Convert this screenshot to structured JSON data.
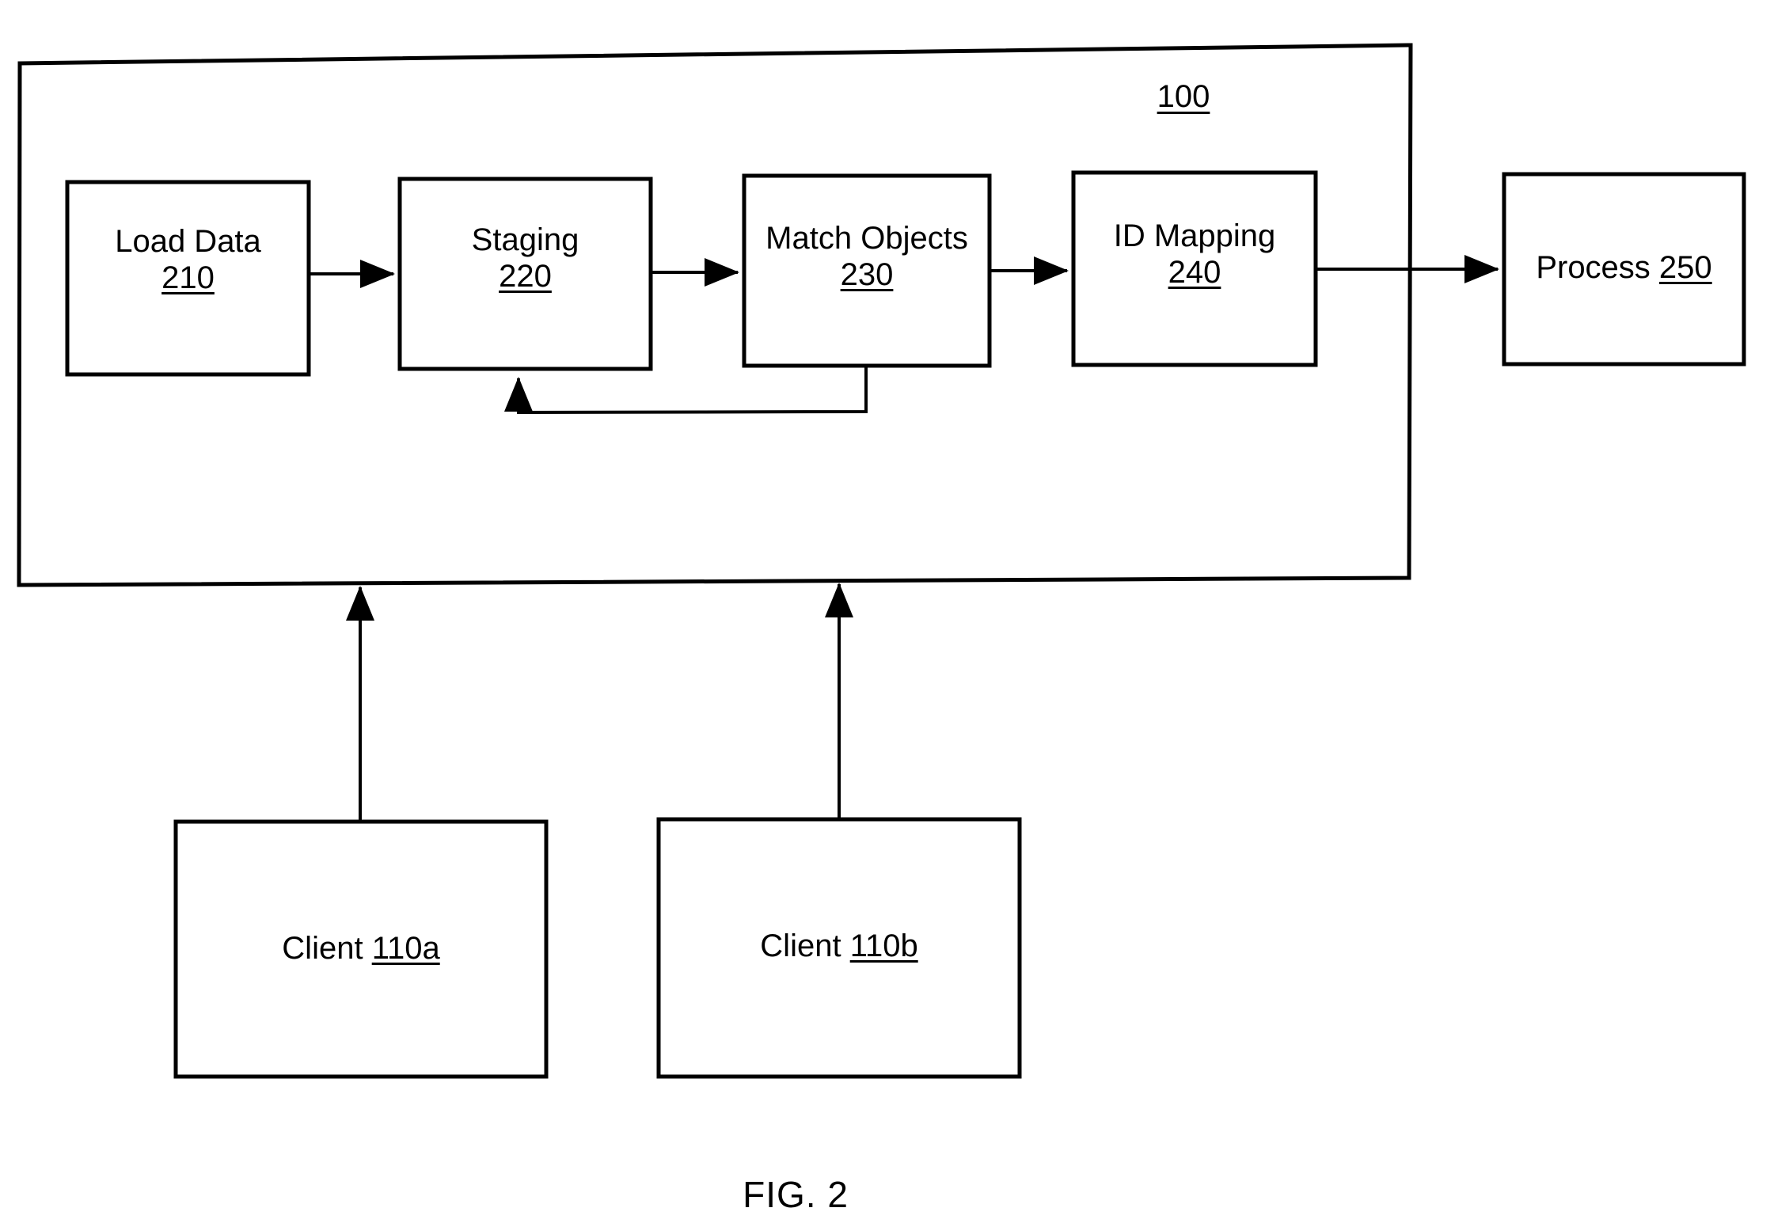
{
  "figure": {
    "caption": "FIG. 2",
    "system_ref": "100"
  },
  "system_container": {
    "name": "system-boundary",
    "ref": "100"
  },
  "nodes": [
    {
      "id": "load-data",
      "name": "Load Data",
      "ref": "210",
      "layout": "two-line"
    },
    {
      "id": "staging",
      "name": "Staging",
      "ref": "220",
      "layout": "two-line"
    },
    {
      "id": "match-objects",
      "name": "Match Objects",
      "ref": "230",
      "layout": "two-line"
    },
    {
      "id": "id-mapping",
      "name": "ID Mapping",
      "ref": "240",
      "layout": "two-line"
    },
    {
      "id": "process",
      "name": "Process ",
      "ref": "250",
      "layout": "one-line"
    },
    {
      "id": "client-a",
      "name": "Client ",
      "ref": "110a",
      "layout": "one-line"
    },
    {
      "id": "client-b",
      "name": "Client ",
      "ref": "110b",
      "layout": "one-line"
    }
  ],
  "connections": [
    {
      "id": "load-to-staging",
      "from": "load-data",
      "to": "staging",
      "kind": "arrow"
    },
    {
      "id": "staging-to-match",
      "from": "staging",
      "to": "match-objects",
      "kind": "arrow"
    },
    {
      "id": "match-to-idmap",
      "from": "match-objects",
      "to": "id-mapping",
      "kind": "arrow"
    },
    {
      "id": "idmap-to-process",
      "from": "id-mapping",
      "to": "process",
      "kind": "arrow"
    },
    {
      "id": "match-feedback",
      "from": "match-objects",
      "to": "staging",
      "kind": "feedback-loop"
    },
    {
      "id": "client-a-to-system",
      "from": "client-a",
      "to": "system-boundary",
      "kind": "arrow"
    },
    {
      "id": "client-b-to-system",
      "from": "client-b",
      "to": "system-boundary",
      "kind": "arrow"
    }
  ],
  "colors": {
    "line": "#000000",
    "background": "#ffffff",
    "text": "#000000"
  }
}
